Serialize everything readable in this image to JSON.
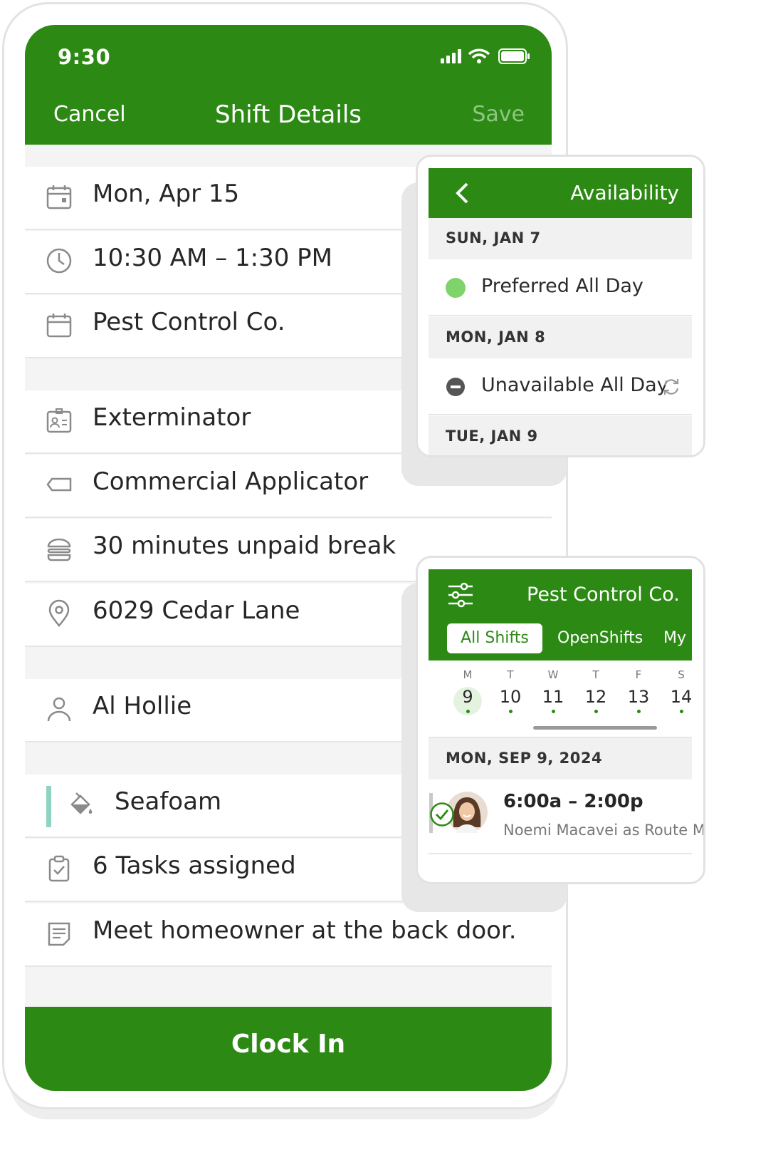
{
  "status_bar": {
    "time": "9:30"
  },
  "nav": {
    "cancel": "Cancel",
    "title": "Shift Details",
    "save": "Save"
  },
  "details": [
    {
      "icon": "calendar-icon",
      "text": "Mon, Apr 15"
    },
    {
      "icon": "clock-icon",
      "text": "10:30 AM – 1:30 PM"
    },
    {
      "icon": "schedule-icon",
      "text": "Pest Control Co."
    },
    {
      "icon": "badge-icon",
      "text": "Exterminator"
    },
    {
      "icon": "tag-icon",
      "text": "Commercial Applicator"
    },
    {
      "icon": "burger-icon",
      "text": "30 minutes unpaid break"
    },
    {
      "icon": "location-pin-icon",
      "text": "6029 Cedar Lane"
    },
    {
      "icon": "person-icon",
      "text": "Al Hollie"
    },
    {
      "icon": "paint-bucket-icon",
      "text": "Seafoam",
      "color": "#8fd4c3"
    },
    {
      "icon": "clipboard-check-icon",
      "text": "6 Tasks assigned"
    },
    {
      "icon": "note-icon",
      "text": "Meet homeowner at the back door."
    }
  ],
  "clock_in": "Clock In",
  "availability": {
    "title": "Availability",
    "days": [
      {
        "date": "SUN, JAN 7",
        "status": "Preferred All Day",
        "color": "#7ed36a"
      },
      {
        "date": "MON, JAN 8",
        "status": "Unavailable All Day",
        "color": "#555555",
        "repeat_icon": "repeat-icon"
      },
      {
        "date": "TUE, JAN 9"
      }
    ]
  },
  "schedule": {
    "title": "Pest Control Co.",
    "tabs": [
      "All Shifts",
      "OpenShifts",
      "My S"
    ],
    "active_tab": "All Shifts",
    "week": [
      {
        "day": "M",
        "num": "9",
        "selected": true
      },
      {
        "day": "T",
        "num": "10"
      },
      {
        "day": "W",
        "num": "11"
      },
      {
        "day": "T",
        "num": "12"
      },
      {
        "day": "F",
        "num": "13"
      },
      {
        "day": "S",
        "num": "14"
      }
    ],
    "date_header": "MON, SEP 9, 2024",
    "shift": {
      "time": "6:00a – 2:00p",
      "who": "Noemi Macavei as Route Ma"
    }
  },
  "colors": {
    "brand_green": "#2c8a14",
    "save_disabled": "#8fc682",
    "preferred": "#7ed36a",
    "seafoam": "#8fd4c3"
  }
}
